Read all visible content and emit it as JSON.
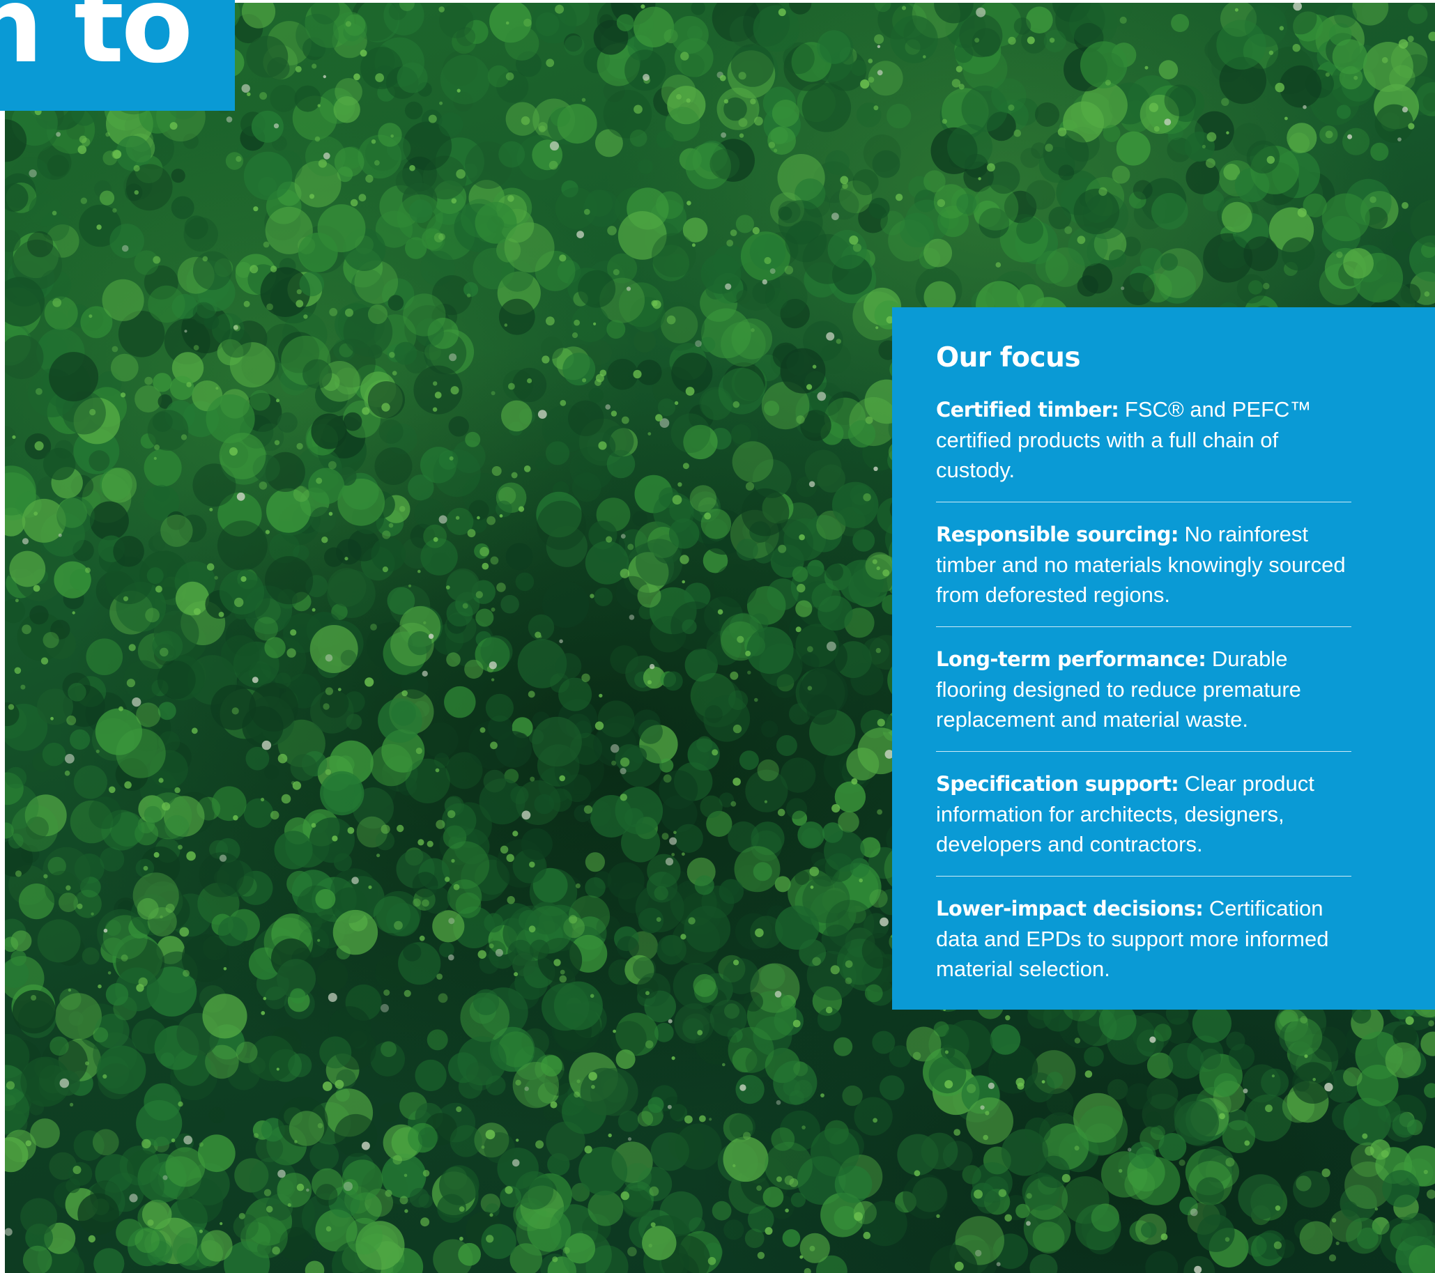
{
  "headline": {
    "text": "n to"
  },
  "colors": {
    "accent": "#0a9ad5",
    "text": "#ffffff",
    "forest_dark": "#0b3420",
    "forest_light": "#2f8a36"
  },
  "focus": {
    "title": "Our focus",
    "items": [
      {
        "lead": "Certified timber:",
        "body": "FSC® and PEFC™ certified products with a full chain of custody."
      },
      {
        "lead": "Responsible sourcing:",
        "body": "No rainforest timber and no materials knowingly sourced from deforested regions."
      },
      {
        "lead": "Long-term performance:",
        "body": "Durable flooring designed to reduce premature replacement and material waste."
      },
      {
        "lead": "Specification support:",
        "body": "Clear product information for architects, designers, developers and contractors."
      },
      {
        "lead": "Lower-impact decisions:",
        "body": "Certification data and EPDs to support more informed material selection."
      }
    ]
  }
}
